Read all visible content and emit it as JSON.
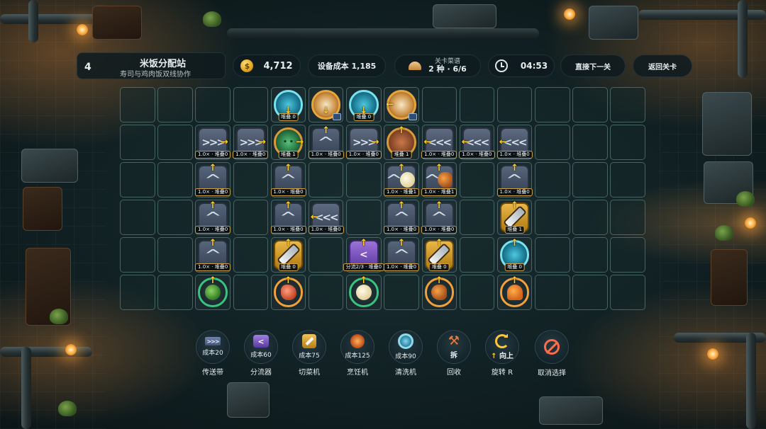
{
  "level": {
    "number": "4",
    "title": "米饭分配站",
    "subtitle": "寿司与鸡肉饭双线协作"
  },
  "hud": {
    "coins": "4,712",
    "equipment_cost_label": "设备成本 1,185",
    "stage_recipes_label": "关卡菜谱",
    "stage_recipes_value": "2 种 · 6/6",
    "timer": "04:53",
    "next_level_button": "直接下一关",
    "back_button": "返回关卡"
  },
  "grid": {
    "columns": 14,
    "rows": 6,
    "tags": {
      "speed": "1.0× · 堆叠0",
      "stack0": "堆叠 0",
      "stack1": "堆叠 1",
      "speed_stack1": "1.0× · 堆叠1",
      "split": "分流2/3 · 堆叠0"
    }
  },
  "toolbar": {
    "conveyor": {
      "cost": "成本20",
      "name": "传送带",
      "icon_glyph": ">>>"
    },
    "splitter": {
      "cost": "成本60",
      "name": "分流器",
      "icon_glyph": "<"
    },
    "cutter": {
      "cost": "成本75",
      "name": "切菜机"
    },
    "cooker": {
      "cost": "成本125",
      "name": "烹饪机"
    },
    "washer": {
      "cost": "成本90",
      "name": "清洗机"
    },
    "recycle": {
      "sub": "拆",
      "name": "回收",
      "icon_glyph": "⚒"
    },
    "rotate": {
      "arrow": "↑",
      "direction": "向上",
      "name": "旋转 R"
    },
    "cancel": {
      "name": "取消选择"
    }
  },
  "colors": {
    "accent_yellow": "#ffcc21",
    "tag_border": "#d3a23e",
    "grid_line": "#82afaa"
  }
}
